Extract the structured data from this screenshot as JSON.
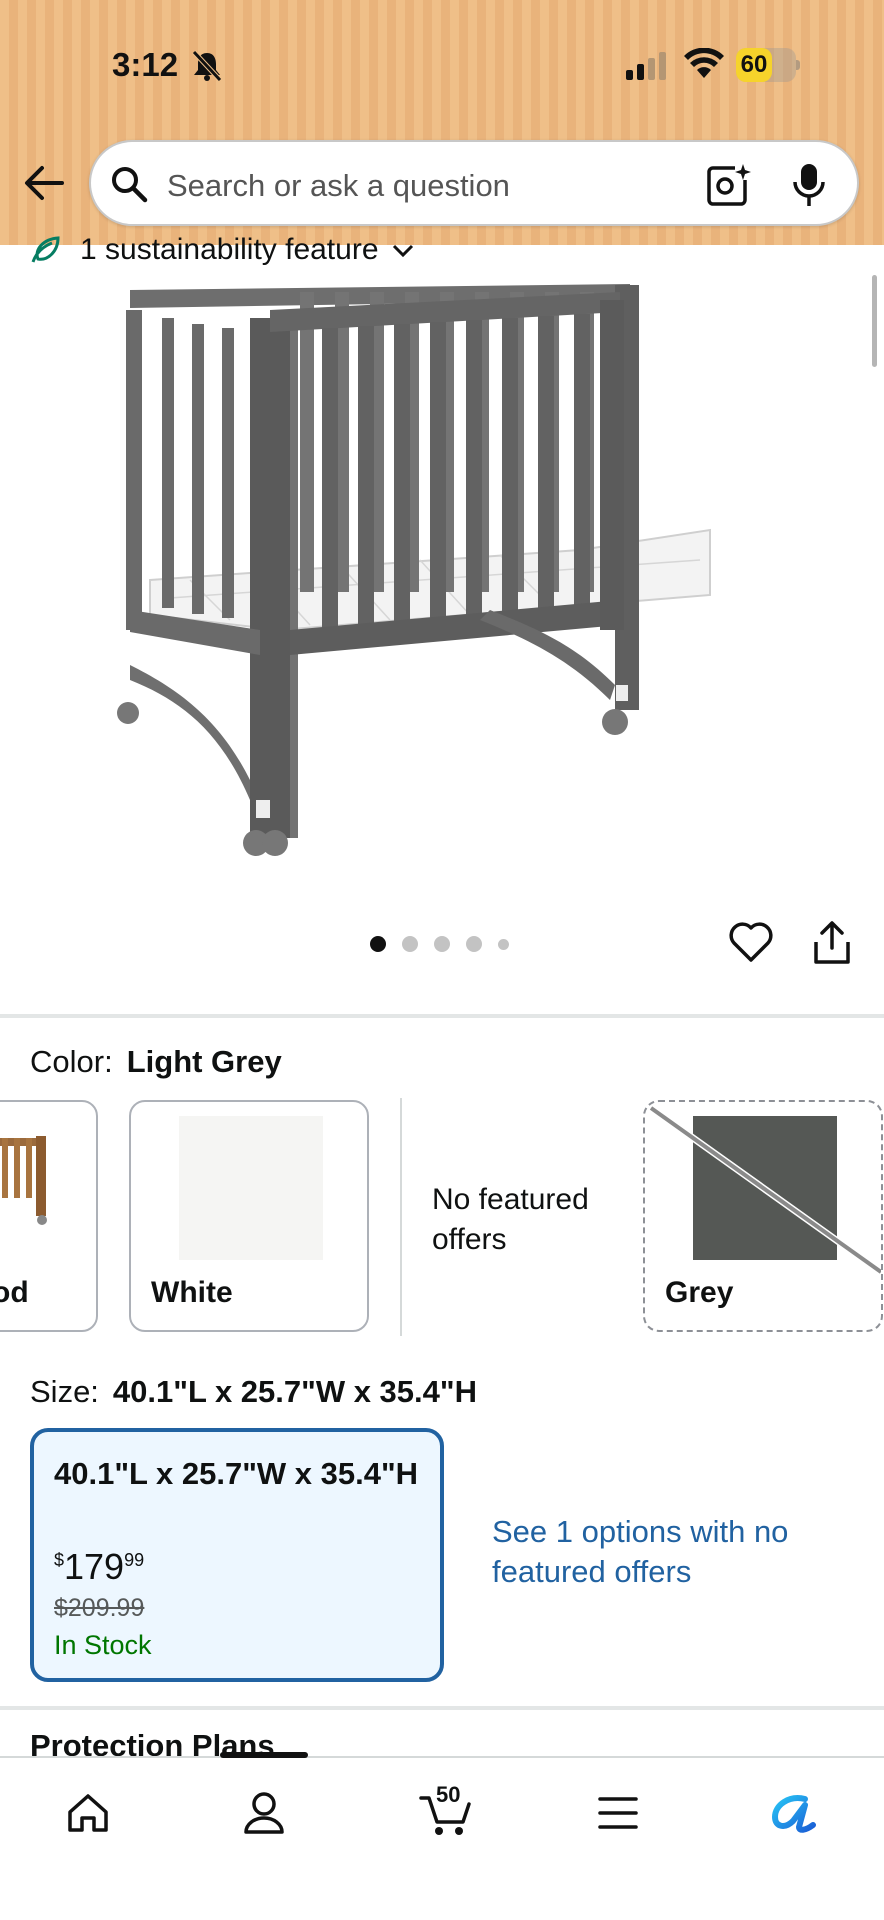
{
  "status_bar": {
    "time": "3:12",
    "battery": "60",
    "battery_level_percent": 60,
    "battery_color": "#f6d32b"
  },
  "search": {
    "placeholder": "Search or ask a question"
  },
  "sustainability": {
    "label": "1 sustainability feature"
  },
  "gallery": {
    "image_name": "grey-mini-crib-photo",
    "image_count": 5,
    "active_index": 0
  },
  "color": {
    "label": "Color:",
    "selected": "Light Grey",
    "swatches": [
      {
        "label": "od"
      },
      {
        "label": "White"
      },
      {
        "label": "Grey"
      }
    ],
    "no_offers": "No featured offers"
  },
  "size": {
    "label": "Size:",
    "selected": "40.1\"L x 25.7\"W x 35.4\"H",
    "card": {
      "name": "40.1\"L x 25.7\"W x 35.4\"H",
      "currency": "$",
      "price_whole": "179",
      "price_fraction": "99",
      "list_price": "$209.99",
      "stock": "In Stock"
    },
    "see_options": "See 1 options with no featured offers"
  },
  "protection": {
    "title": "Protection Plans"
  },
  "bottom_nav": {
    "cart_count": "50",
    "items": [
      "home-icon",
      "account-icon",
      "cart-icon",
      "menu-icon",
      "rufus-icon"
    ]
  },
  "colors": {
    "link": "#2162a1",
    "stock": "#007600",
    "accent": "#efbf88"
  }
}
